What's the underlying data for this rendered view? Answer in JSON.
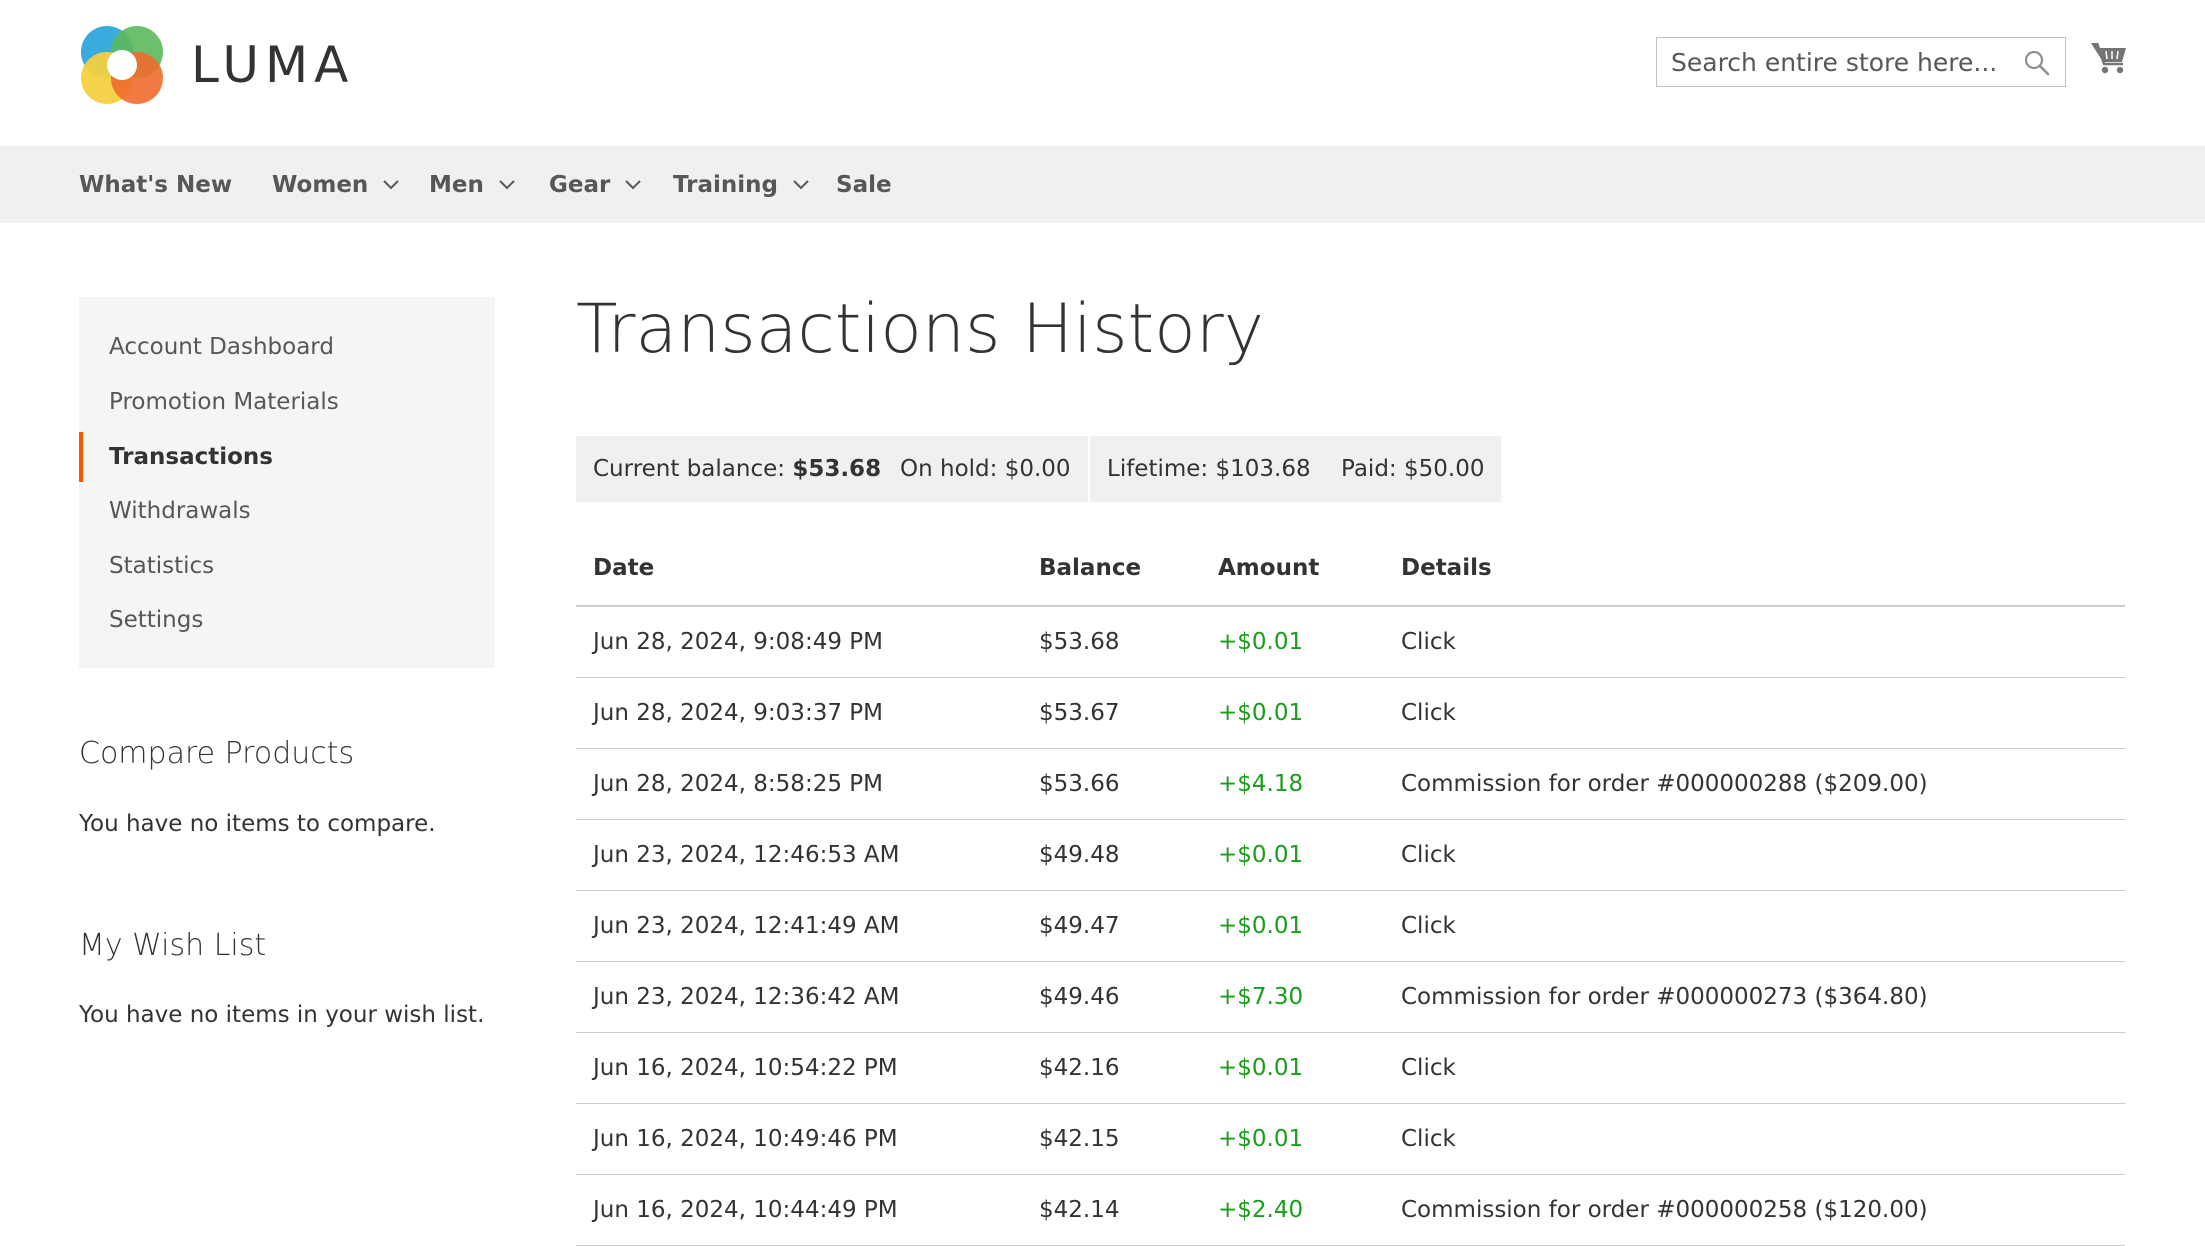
{
  "brand": {
    "name": "LUMA"
  },
  "search": {
    "placeholder": "Search entire store here..."
  },
  "nav": [
    {
      "label": "What's New",
      "has_submenu": false
    },
    {
      "label": "Women",
      "has_submenu": true
    },
    {
      "label": "Men",
      "has_submenu": true
    },
    {
      "label": "Gear",
      "has_submenu": true
    },
    {
      "label": "Training",
      "has_submenu": true
    },
    {
      "label": "Sale",
      "has_submenu": false
    }
  ],
  "account_nav": {
    "items": [
      {
        "label": "Account Dashboard"
      },
      {
        "label": "Promotion Materials"
      },
      {
        "label": "Transactions",
        "active": true
      },
      {
        "label": "Withdrawals"
      },
      {
        "label": "Statistics"
      },
      {
        "label": "Settings"
      }
    ]
  },
  "compare": {
    "title": "Compare Products",
    "empty": "You have no items to compare."
  },
  "wishlist": {
    "title": "My Wish List",
    "empty": "You have no items in your wish list."
  },
  "page": {
    "title": "Transactions History"
  },
  "summary": {
    "current_balance_label": "Current balance: ",
    "current_balance_value": "$53.68",
    "on_hold": "On hold: $0.00",
    "lifetime": "Lifetime: $103.68",
    "paid": "Paid: $50.00"
  },
  "table": {
    "columns": {
      "date": "Date",
      "balance": "Balance",
      "amount": "Amount",
      "details": "Details"
    },
    "rows": [
      {
        "date": "Jun 28, 2024, 9:08:49 PM",
        "balance": "$53.68",
        "amount": "+$0.01",
        "details": "Click"
      },
      {
        "date": "Jun 28, 2024, 9:03:37 PM",
        "balance": "$53.67",
        "amount": "+$0.01",
        "details": "Click"
      },
      {
        "date": "Jun 28, 2024, 8:58:25 PM",
        "balance": "$53.66",
        "amount": "+$4.18",
        "details": "Commission for order #000000288 ($209.00)"
      },
      {
        "date": "Jun 23, 2024, 12:46:53 AM",
        "balance": "$49.48",
        "amount": "+$0.01",
        "details": "Click"
      },
      {
        "date": "Jun 23, 2024, 12:41:49 AM",
        "balance": "$49.47",
        "amount": "+$0.01",
        "details": "Click"
      },
      {
        "date": "Jun 23, 2024, 12:36:42 AM",
        "balance": "$49.46",
        "amount": "+$7.30",
        "details": "Commission for order #000000273 ($364.80)"
      },
      {
        "date": "Jun 16, 2024, 10:54:22 PM",
        "balance": "$42.16",
        "amount": "+$0.01",
        "details": "Click"
      },
      {
        "date": "Jun 16, 2024, 10:49:46 PM",
        "balance": "$42.15",
        "amount": "+$0.01",
        "details": "Click"
      },
      {
        "date": "Jun 16, 2024, 10:44:49 PM",
        "balance": "$42.14",
        "amount": "+$2.40",
        "details": "Commission for order #000000258 ($120.00)"
      }
    ]
  },
  "colors": {
    "accent": "#ff5501",
    "positive": "#1a9d1a",
    "nav_bg": "#f0f0f0",
    "sidebar_bg": "#f5f5f5"
  },
  "icons": {
    "logo": "luma-logo-icon",
    "search": "search-icon",
    "cart": "cart-icon",
    "submenu": "chevron-down-icon"
  }
}
